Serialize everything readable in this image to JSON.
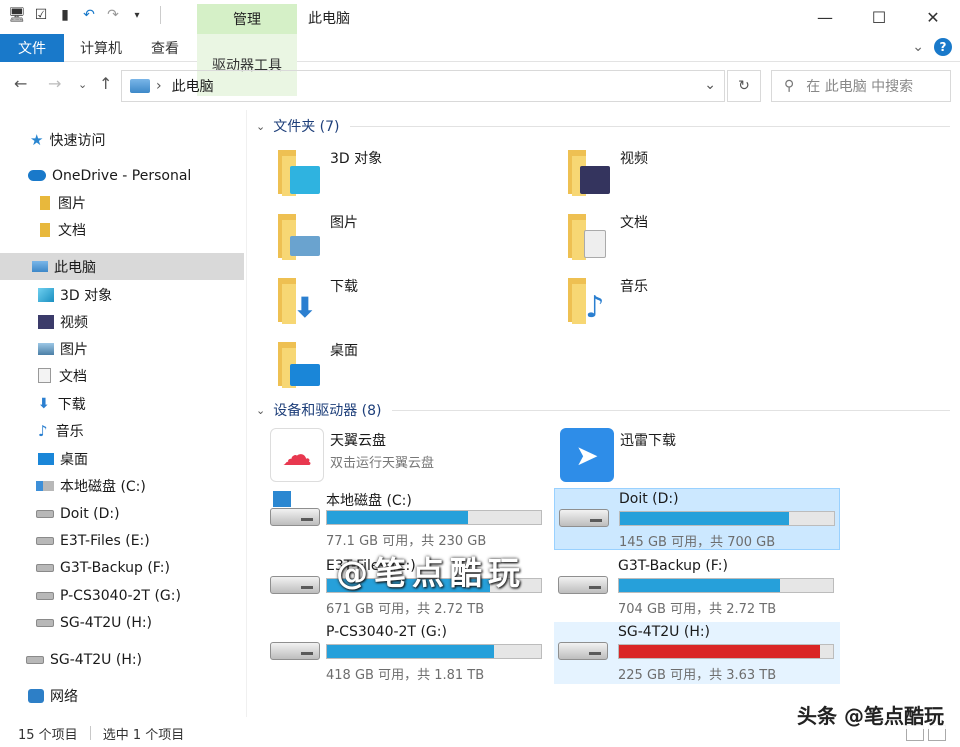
{
  "titlebar": {
    "manage_tab": "管理",
    "title": "此电脑",
    "controls": {
      "minimize": "—",
      "maximize": "☐",
      "close": "✕"
    }
  },
  "ribbon": {
    "tabs": [
      {
        "label": "文件",
        "id": "file"
      },
      {
        "label": "计算机",
        "id": "computer"
      },
      {
        "label": "查看",
        "id": "view"
      },
      {
        "label": "驱动器工具",
        "id": "drive-tools"
      }
    ],
    "help": "?"
  },
  "address": {
    "path": "此电脑",
    "search_placeholder": "在 此电脑 中搜索"
  },
  "sidebar": {
    "items": [
      {
        "label": "快速访问",
        "icon": "star-icon"
      },
      {
        "label": "OneDrive - Personal",
        "icon": "cloud-icon"
      },
      {
        "label": "图片",
        "icon": "folder-icon"
      },
      {
        "label": "文档",
        "icon": "folder-icon"
      },
      {
        "label": "此电脑",
        "icon": "computer-icon",
        "selected": true
      },
      {
        "label": "3D 对象",
        "icon": "3d-objects-icon"
      },
      {
        "label": "视频",
        "icon": "video-icon"
      },
      {
        "label": "图片",
        "icon": "pictures-icon"
      },
      {
        "label": "文档",
        "icon": "documents-icon"
      },
      {
        "label": "下载",
        "icon": "download-icon"
      },
      {
        "label": "音乐",
        "icon": "music-icon"
      },
      {
        "label": "桌面",
        "icon": "desktop-icon"
      },
      {
        "label": "本地磁盘 (C:)",
        "icon": "system-drive-icon"
      },
      {
        "label": "Doit (D:)",
        "icon": "drive-icon"
      },
      {
        "label": "E3T-Files (E:)",
        "icon": "drive-icon"
      },
      {
        "label": "G3T-Backup (F:)",
        "icon": "drive-icon"
      },
      {
        "label": "P-CS3040-2T (G:)",
        "icon": "drive-icon"
      },
      {
        "label": "SG-4T2U (H:)",
        "icon": "drive-icon"
      },
      {
        "label": "SG-4T2U (H:)",
        "icon": "drive-icon"
      },
      {
        "label": "网络",
        "icon": "network-icon"
      }
    ]
  },
  "folders_group": {
    "header": "文件夹 (7)",
    "items": [
      {
        "label": "3D 对象",
        "icon": "3d-objects-icon",
        "overlay_color": "#2fb3e0"
      },
      {
        "label": "视频",
        "icon": "video-icon",
        "overlay_color": "#34345e"
      },
      {
        "label": "图片",
        "icon": "pictures-icon",
        "overlay_color": "#6aa3cf"
      },
      {
        "label": "文档",
        "icon": "documents-icon",
        "overlay_color": "#eeeeee"
      },
      {
        "label": "下载",
        "icon": "download-icon",
        "overlay_color": "#2b7fd0"
      },
      {
        "label": "音乐",
        "icon": "music-icon",
        "overlay_color": "#2b7fd0"
      },
      {
        "label": "桌面",
        "icon": "desktop-icon",
        "overlay_color": "#1a86d8"
      }
    ]
  },
  "devices_group": {
    "header": "设备和驱动器 (8)",
    "apps": [
      {
        "name": "天翼云盘",
        "sub": "双击运行天翼云盘",
        "icon": "tianyi-cloud-icon"
      },
      {
        "name": "迅雷下载",
        "sub": "",
        "icon": "xunlei-icon"
      }
    ],
    "drives": [
      {
        "name": "本地磁盘 (C:)",
        "free": "77.1 GB 可用，共 230 GB",
        "used_percent": 66,
        "color": "#26a0da",
        "system": true
      },
      {
        "name": "Doit (D:)",
        "free": "145 GB 可用，共 700 GB",
        "used_percent": 79,
        "color": "#26a0da",
        "selected": true
      },
      {
        "name": "E3T-Files (E:)",
        "free": "671 GB 可用，共 2.72 TB",
        "used_percent": 76,
        "color": "#26a0da"
      },
      {
        "name": "G3T-Backup (F:)",
        "free": "704 GB 可用，共 2.72 TB",
        "used_percent": 75,
        "color": "#26a0da"
      },
      {
        "name": "P-CS3040-2T (G:)",
        "free": "418 GB 可用，共 1.81 TB",
        "used_percent": 78,
        "color": "#26a0da"
      },
      {
        "name": "SG-4T2U (H:)",
        "free": "225 GB 可用，共 3.63 TB",
        "used_percent": 94,
        "color": "#da2626",
        "hover": true
      }
    ]
  },
  "statusbar": {
    "count": "15 个项目",
    "selected": "选中 1 个项目"
  },
  "watermark": {
    "center": "@笔点酷玩",
    "corner": "头条 @笔点酷玩"
  }
}
